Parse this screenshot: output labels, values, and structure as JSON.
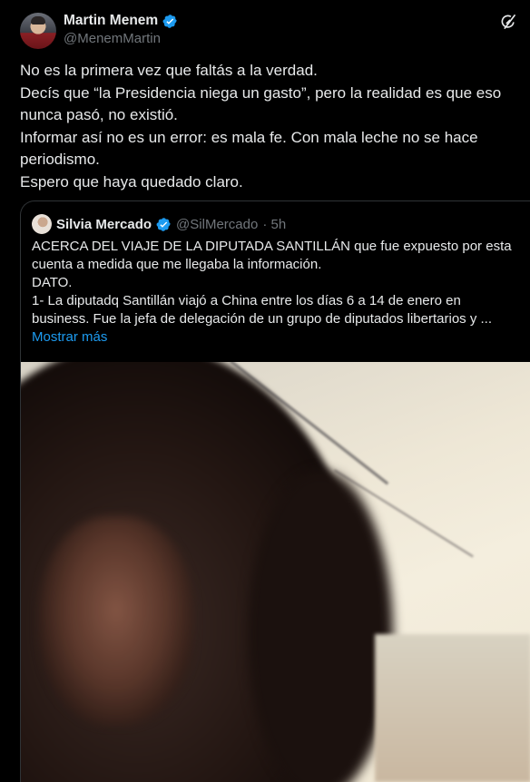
{
  "tweet": {
    "author_name": "Martin Menem",
    "author_handle": "@MenemMartin",
    "verified": true,
    "text_lines": [
      "No es la primera vez que faltás a la verdad.",
      "Decís que “la Presidencia niega un gasto”, pero la realidad es que eso nunca pasó, no existió.",
      "Informar así no es un error: es mala fe. Con mala leche no se hace periodismo.",
      "Espero que haya quedado claro."
    ]
  },
  "quoted": {
    "author_name": "Silvia Mercado",
    "author_handle": "@SilMercado",
    "time": "· 5h",
    "verified": true,
    "text_lines": [
      "ACERCA DEL VIAJE DE LA DIPUTADA SANTILLÁN que fue expuesto por esta",
      "cuenta a medida que me llegaba la información.",
      "DATO.",
      "1- La diputadq Santillán viajó a China entre los días 6 a 14 de enero en",
      "business. Fue la jefa de delegación de un grupo de diputados libertarios y ..."
    ],
    "show_more": "Mostrar más"
  },
  "icons": {
    "verified": "verified-badge-icon",
    "grok": "grok-icon"
  },
  "colors": {
    "background": "#000000",
    "text": "#e7e9ea",
    "secondary": "#71767b",
    "accent": "#1d9bf0",
    "border": "#2f3336"
  }
}
